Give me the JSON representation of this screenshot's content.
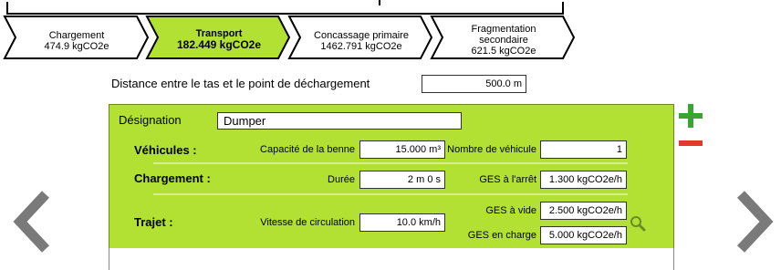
{
  "steps": [
    {
      "name": "Chargement",
      "value": "474.9 kgCO2e",
      "active": false
    },
    {
      "name": "Transport",
      "value": "182.449 kgCO2e",
      "active": true
    },
    {
      "name": "Concassage primaire",
      "value": "1462.791 kgCO2e",
      "active": false
    },
    {
      "name_line1": "Fragmentation",
      "name_line2": "secondaire",
      "value": "621.5 kgCO2e",
      "active": false
    }
  ],
  "colors": {
    "active_step": "#b2e134",
    "panel": "#b2e134",
    "add": "#3aa335",
    "remove": "#e03a2e",
    "nav": "#7a7a7a"
  },
  "distance": {
    "label": "Distance entre le tas et le point de déchargement",
    "value": "500.0 m"
  },
  "panel": {
    "designation_label": "Désignation",
    "designation_value": "Dumper",
    "vehicules": {
      "title": "Véhicules :",
      "capacity_label": "Capacité de la benne",
      "capacity_value": "15.000 m³",
      "count_label": "Nombre de véhicule",
      "count_value": "1"
    },
    "chargement": {
      "title": "Chargement :",
      "duration_label": "Durée",
      "duration_value": "2 m 0 s",
      "ges_stop_label": "GES à l'arrêt",
      "ges_stop_value": "1.300 kgCO2e/h"
    },
    "trajet": {
      "title": "Trajet :",
      "speed_label": "Vitesse de circulation",
      "speed_value": "10.0 km/h",
      "ges_empty_label": "GES à vide",
      "ges_empty_value": "2.500 kgCO2e/h",
      "ges_loaded_label": "GES en charge",
      "ges_loaded_value": "5.000 kgCO2e/h"
    }
  },
  "icons": {
    "add": "plus-icon",
    "remove": "minus-icon",
    "search": "search-icon",
    "prev": "chevron-left-icon",
    "next": "chevron-right-icon"
  }
}
